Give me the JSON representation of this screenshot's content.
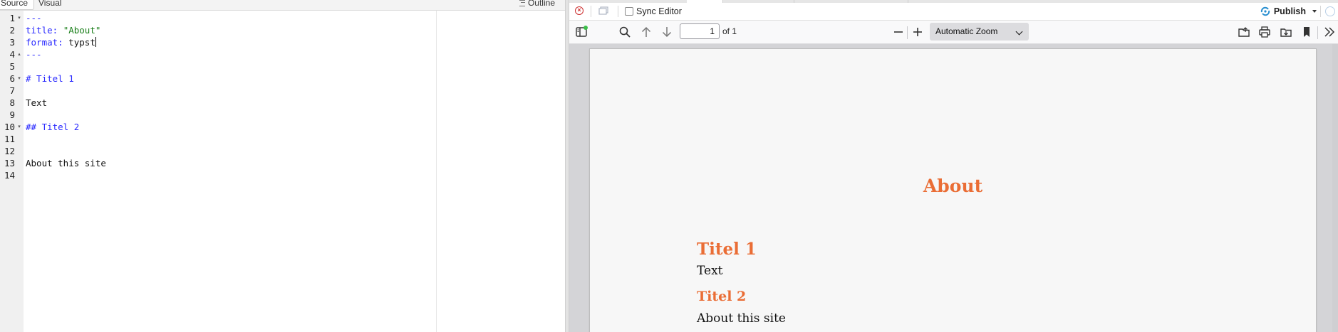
{
  "editor": {
    "tabs": {
      "source_label": "Source",
      "visual_label": "Visual",
      "outline_label": "Outline"
    },
    "lines": [
      {
        "num": "1",
        "fold": "▾",
        "segments": [
          {
            "text": "---",
            "color": "blue"
          }
        ]
      },
      {
        "num": "2",
        "fold": "",
        "segments": [
          {
            "text": "title: ",
            "color": "blue"
          },
          {
            "text": "\"About\"",
            "color": "green"
          }
        ]
      },
      {
        "num": "3",
        "fold": "",
        "segments": [
          {
            "text": "format: ",
            "color": "blue"
          },
          {
            "text": "typst",
            "color": "black"
          }
        ],
        "cursor": true
      },
      {
        "num": "4",
        "fold": "▴",
        "segments": [
          {
            "text": "---",
            "color": "blue"
          }
        ]
      },
      {
        "num": "5",
        "fold": "",
        "segments": []
      },
      {
        "num": "6",
        "fold": "▾",
        "segments": [
          {
            "text": "# Titel 1",
            "color": "blue"
          }
        ]
      },
      {
        "num": "7",
        "fold": "",
        "segments": []
      },
      {
        "num": "8",
        "fold": "",
        "segments": [
          {
            "text": "Text",
            "color": "black"
          }
        ]
      },
      {
        "num": "9",
        "fold": "",
        "segments": []
      },
      {
        "num": "10",
        "fold": "▾",
        "segments": [
          {
            "text": "## Titel 2",
            "color": "blue"
          }
        ]
      },
      {
        "num": "11",
        "fold": "",
        "segments": []
      },
      {
        "num": "12",
        "fold": "",
        "segments": []
      },
      {
        "num": "13",
        "fold": "",
        "segments": [
          {
            "text": "About this site",
            "color": "black"
          }
        ]
      },
      {
        "num": "14",
        "fold": "",
        "segments": []
      }
    ]
  },
  "viewer": {
    "toolbar1": {
      "close_icon": "close-icon",
      "popout_icon": "popout-window-icon",
      "sync_editor_label": "Sync Editor",
      "sync_editor_checked": false,
      "publish_label": "Publish",
      "publish_icon": "publish-icon"
    },
    "toolbar2": {
      "sidebar_toggle_icon": "sidebar-toggle-icon",
      "search_icon": "search-icon",
      "prev_page_icon": "arrow-up-icon",
      "next_page_icon": "arrow-down-icon",
      "page_number": "1",
      "page_count_label": "of 1",
      "zoom_out_icon": "minus-icon",
      "zoom_in_icon": "plus-icon",
      "zoom_value": "Automatic Zoom",
      "open_file_icon": "open-file-icon",
      "print_icon": "print-icon",
      "save_icon": "save-icon",
      "bookmark_icon": "bookmark-icon",
      "more_tools_icon": "double-chevron-right-icon"
    },
    "document": {
      "title": "About",
      "heading1": "Titel 1",
      "paragraph1": "Text",
      "heading2": "Titel 2",
      "paragraph2": "About this site"
    },
    "colors": {
      "heading_accent": "#ea6d35",
      "yaml_blue": "#2a2aff",
      "string_green": "#1a7f1a",
      "close_red": "#cc2b2b",
      "publish_blue": "#2a8fd0"
    }
  }
}
